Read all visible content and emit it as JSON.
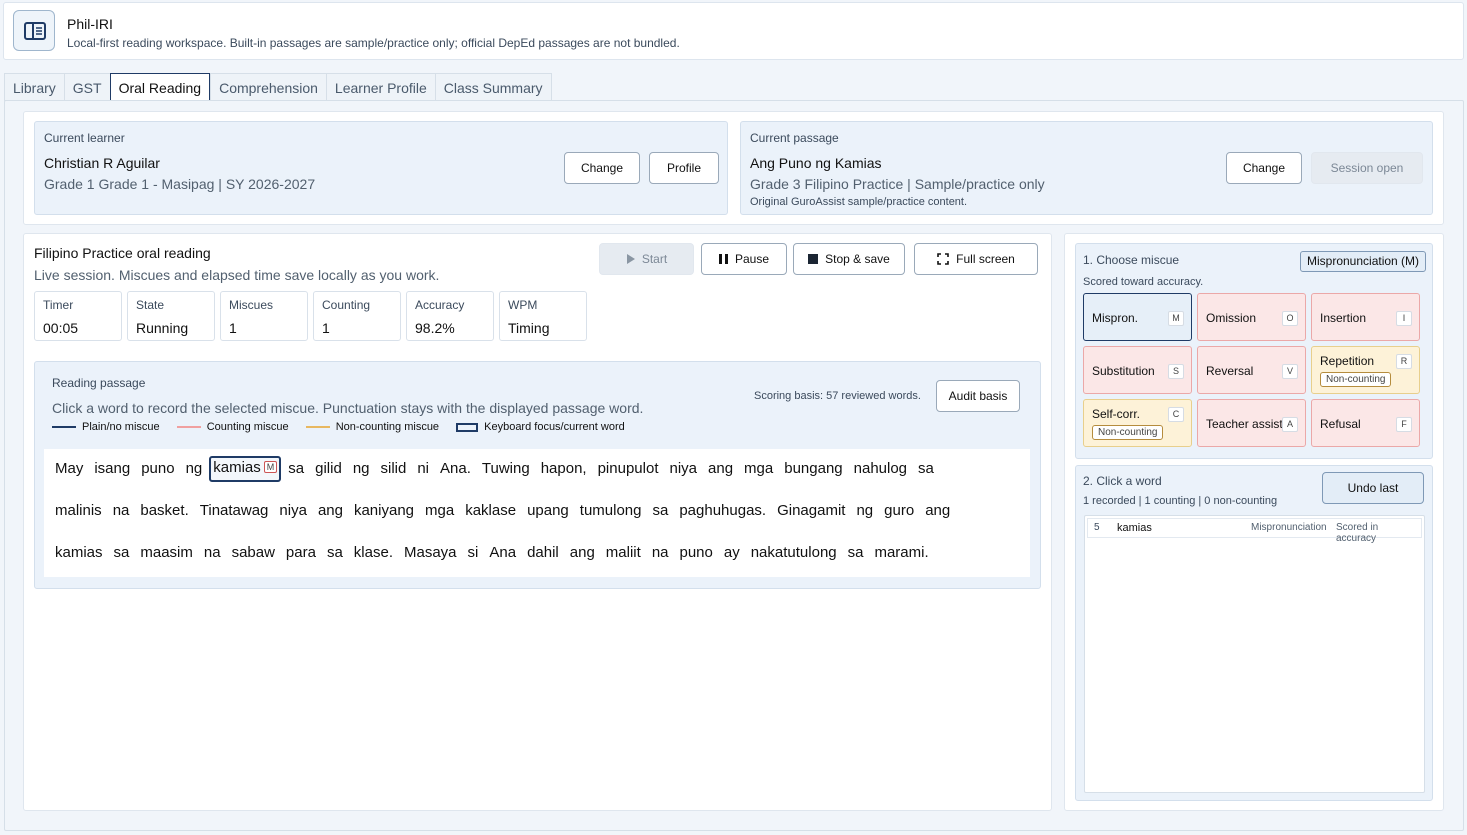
{
  "app": {
    "title": "Phil-IRI",
    "subtitle": "Local-first reading workspace. Built-in passages are sample/practice only; official DepEd passages are not bundled."
  },
  "tabs": [
    {
      "label": "Library"
    },
    {
      "label": "GST"
    },
    {
      "label": "Oral Reading"
    },
    {
      "label": "Comprehension"
    },
    {
      "label": "Learner Profile"
    },
    {
      "label": "Class Summary"
    }
  ],
  "learner": {
    "heading": "Current learner",
    "name": "Christian R Aguilar",
    "meta": "Grade 1 Grade 1 - Masipag | SY 2026-2027",
    "change_label": "Change",
    "profile_label": "Profile"
  },
  "passage_card": {
    "heading": "Current passage",
    "title": "Ang Puno ng Kamias",
    "meta": "Grade 3 Filipino Practice | Sample/practice only",
    "note": "Original GuroAssist sample/practice content.",
    "change_label": "Change",
    "session_label": "Session open"
  },
  "session": {
    "title": "Filipino Practice oral reading",
    "subtitle": "Live session. Miscues and elapsed time save locally as you work.",
    "start_label": "Start",
    "pause_label": "Pause",
    "stop_label": "Stop & save",
    "fullscreen_label": "Full screen"
  },
  "stats": [
    {
      "label": "Timer",
      "value": "00:05"
    },
    {
      "label": "State",
      "value": "Running"
    },
    {
      "label": "Miscues",
      "value": "1"
    },
    {
      "label": "Counting",
      "value": "1"
    },
    {
      "label": "Accuracy",
      "value": "98.2%"
    },
    {
      "label": "WPM",
      "value": "Timing"
    }
  ],
  "reading": {
    "heading": "Reading passage",
    "instructions": "Click a word to record the selected miscue. Punctuation stays with the displayed passage word.",
    "scoring_basis": "Scoring basis: 57 reviewed words.",
    "audit_label": "Audit basis",
    "legend": [
      {
        "label": "Plain/no miscue",
        "color": "#1f3b66"
      },
      {
        "label": "Counting miscue",
        "color": "#f0a0a0"
      },
      {
        "label": "Non-counting miscue",
        "color": "#e8b860"
      },
      {
        "label": "Keyboard focus/current word",
        "color": "#1f3b66"
      }
    ],
    "lines": [
      [
        "May",
        "isang",
        "puno",
        "ng",
        "kamias",
        "sa",
        "gilid",
        "ng",
        "silid",
        "ni",
        "Ana.",
        "Tuwing",
        "hapon,",
        "pinupulot",
        "niya",
        "ang",
        "mga",
        "bungang",
        "nahulog",
        "sa"
      ],
      [
        "malinis",
        "na",
        "basket.",
        "Tinatawag",
        "niya",
        "ang",
        "kaniyang",
        "mga",
        "kaklase",
        "upang",
        "tumulong",
        "sa",
        "paghuhugas.",
        "Ginagamit",
        "ng",
        "guro",
        "ang"
      ],
      [
        "kamias",
        "sa",
        "maasim",
        "na",
        "sabaw",
        "para",
        "sa",
        "klase.",
        "Masaya",
        "si",
        "Ana",
        "dahil",
        "ang",
        "maliit",
        "na",
        "puno",
        "ay",
        "nakatutulong",
        "sa",
        "marami."
      ]
    ],
    "marked_word_tag": "M"
  },
  "miscue_panel": {
    "heading": "1. Choose miscue",
    "selected_badge": "Mispronunciation (M)",
    "scored_note": "Scored toward accuracy.",
    "noncounting_label": "Non-counting",
    "types": [
      {
        "label": "Mispron.",
        "key": "M"
      },
      {
        "label": "Omission",
        "key": "O"
      },
      {
        "label": "Insertion",
        "key": "I"
      },
      {
        "label": "Substitution",
        "key": "S"
      },
      {
        "label": "Reversal",
        "key": "V"
      },
      {
        "label": "Repetition",
        "key": "R"
      },
      {
        "label": "Self-corr.",
        "key": "C"
      },
      {
        "label": "Teacher assist",
        "key": "A"
      },
      {
        "label": "Refusal",
        "key": "F"
      }
    ]
  },
  "record_panel": {
    "heading": "2. Click a word",
    "summary": "1 recorded | 1 counting | 0 non-counting",
    "undo_label": "Undo last",
    "records": [
      {
        "index": "5",
        "word": "kamias",
        "type": "Mispronunciation",
        "status": "Scored in accuracy"
      }
    ]
  }
}
